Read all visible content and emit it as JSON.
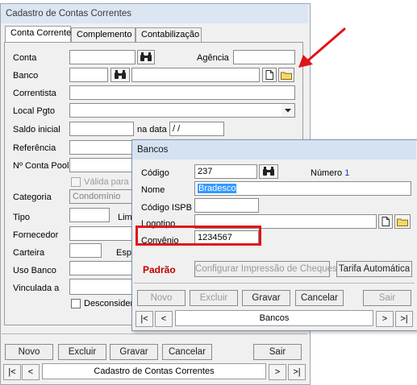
{
  "main_window": {
    "title": "Cadastro de Contas Correntes",
    "tabs": [
      "Conta Corrente",
      "Complemento",
      "Contabilização"
    ],
    "labels": {
      "conta": "Conta",
      "agencia": "Agência",
      "banco": "Banco",
      "correntista": "Correntista",
      "local_pgto": "Local Pgto",
      "saldo_inicial": "Saldo inicial",
      "na_data": "na data",
      "referencia": "Referência",
      "n_conta_pool": "Nº Conta Pool",
      "valida_para": "Válida para",
      "categoria": "Categoria",
      "tipo": "Tipo",
      "lim": "Lim",
      "fornecedor": "Fornecedor",
      "carteira": "Carteira",
      "esp": "Esp",
      "uso_banco": "Uso Banco",
      "vinculada_a": "Vinculada a",
      "desconsider": "Desconsider"
    },
    "values": {
      "saldo_date": " / /",
      "categoria": "Condomínio"
    },
    "buttons": {
      "novo": "Novo",
      "excluir": "Excluir",
      "gravar": "Gravar",
      "cancelar": "Cancelar",
      "sair": "Sair"
    },
    "nav": {
      "first": "|<",
      "prev": "<",
      "caption": "Cadastro de Contas Correntes",
      "next": ">",
      "last": ">|"
    }
  },
  "dialog": {
    "title": "Bancos",
    "labels": {
      "codigo": "Código",
      "numero": "Número",
      "nome": "Nome",
      "codigo_ispb": "Código ISPB",
      "logotipo": "Logotipo",
      "convenio": "Convênio"
    },
    "values": {
      "codigo": "237",
      "numero": "1",
      "nome": "Bradesco",
      "codigo_ispb": "",
      "logotipo": "",
      "convenio": "1234567"
    },
    "padrao": "Padrão",
    "configurar": "Configurar Impressão de Cheques",
    "tarifa": "Tarifa Automática",
    "buttons": {
      "novo": "Novo",
      "excluir": "Excluir",
      "gravar": "Gravar",
      "cancelar": "Cancelar",
      "sair": "Sair"
    },
    "nav": {
      "first": "|<",
      "prev": "<",
      "caption": "Bancos",
      "next": ">",
      "last": ">|"
    }
  },
  "colors": {
    "highlight_box": "#e0141a",
    "arrow": "#e0141a",
    "padrao": "#c00000",
    "selection": "#3399ff",
    "numero_value": "#1f3fae"
  },
  "icons": {
    "search": "binoculars-icon",
    "new_document": "document-icon",
    "open_folder": "folder-icon"
  }
}
